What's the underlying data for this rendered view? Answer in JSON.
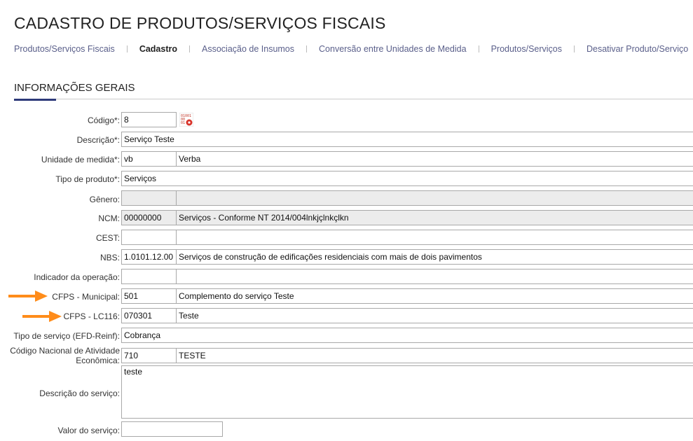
{
  "page": {
    "title": "CADASTRO DE PRODUTOS/SERVIÇOS FISCAIS"
  },
  "nav": [
    {
      "label": "Produtos/Serviços Fiscais"
    },
    {
      "label": "Cadastro"
    },
    {
      "label": "Associação de Insumos"
    },
    {
      "label": "Conversão entre Unidades de Medida"
    },
    {
      "label": "Produtos/Serviços"
    },
    {
      "label": "Desativar Produto/Serviço"
    }
  ],
  "section": {
    "title": "INFORMAÇÕES GERAIS"
  },
  "form": {
    "codigo": {
      "label": "Código*:",
      "value": "8"
    },
    "descricao": {
      "label": "Descrição*:",
      "value": "Serviço Teste"
    },
    "unidade": {
      "label": "Unidade de medida*:",
      "code": "vb",
      "name": "Verba"
    },
    "tipo_produto": {
      "label": "Tipo de produto*:",
      "value": "Serviços"
    },
    "genero": {
      "label": "Gênero:",
      "code": "",
      "name": ""
    },
    "ncm": {
      "label": "NCM:",
      "code": "00000000",
      "name": "Serviços - Conforme NT 2014/004lnkjçlnkçlkn"
    },
    "cest": {
      "label": "CEST:",
      "code": "",
      "name": ""
    },
    "nbs": {
      "label": "NBS:",
      "code": "1.0101.12.00",
      "name": "Serviços de construção de edificações residenciais com mais de dois pavimentos"
    },
    "indicador": {
      "label": "Indicador da operação:",
      "code": "",
      "name": ""
    },
    "cfps_municipal": {
      "label": "CFPS - Municipal:",
      "code": "501",
      "name": "Complemento do serviço Teste"
    },
    "cfps_lc116": {
      "label": "CFPS - LC116:",
      "code": "070301",
      "name": "Teste"
    },
    "tipo_servico": {
      "label": "Tipo de serviço (EFD-Reinf):",
      "value": "Cobrança"
    },
    "cnae": {
      "label": "Código Nacional de Atividade Econômica:",
      "code": "710",
      "name": "TESTE"
    },
    "descricao_servico": {
      "label": "Descrição do serviço:",
      "value": "teste"
    },
    "valor_servico": {
      "label": "Valor do serviço:",
      "value": ""
    }
  },
  "icons": {
    "generate_code": "binary-gear-icon",
    "arrows": "orange-arrow-icon"
  },
  "colors": {
    "accent": "#2e3a7a",
    "arrow": "#ff8c1a",
    "nav_link": "#5a5f8a"
  }
}
